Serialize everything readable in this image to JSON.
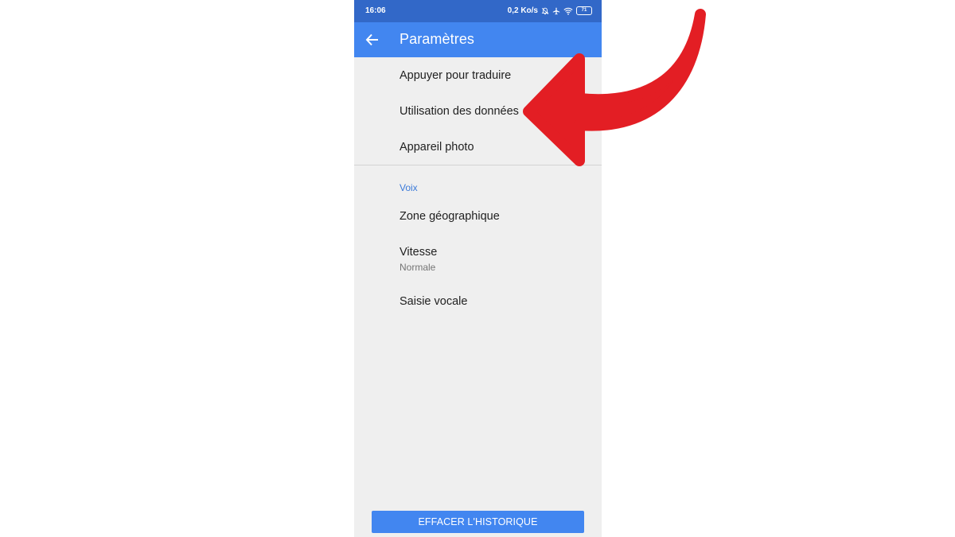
{
  "status_bar": {
    "time": "16:06",
    "network_speed": "0,2 Ko/s",
    "battery_level": "71",
    "icons": [
      "bell-muted-icon",
      "airplane-icon",
      "wifi-icon",
      "battery-icon"
    ]
  },
  "app_bar": {
    "title": "Paramètres",
    "back_icon": "arrow-left-icon"
  },
  "settings": {
    "items": [
      {
        "label": "Appuyer pour traduire"
      },
      {
        "label": "Utilisation des données"
      },
      {
        "label": "Appareil photo"
      }
    ],
    "voice_section": {
      "header": "Voix",
      "items": [
        {
          "label": "Zone géographique"
        },
        {
          "label": "Vitesse",
          "value": "Normale"
        },
        {
          "label": "Saisie vocale"
        }
      ]
    }
  },
  "footer": {
    "clear_history_label": "EFFACER L'HISTORIQUE"
  },
  "colors": {
    "status_bar": "#3268c8",
    "app_bar": "#4286f0",
    "accent": "#3b7ad9",
    "background": "#efefef",
    "annotation_arrow": "#e31e24"
  }
}
